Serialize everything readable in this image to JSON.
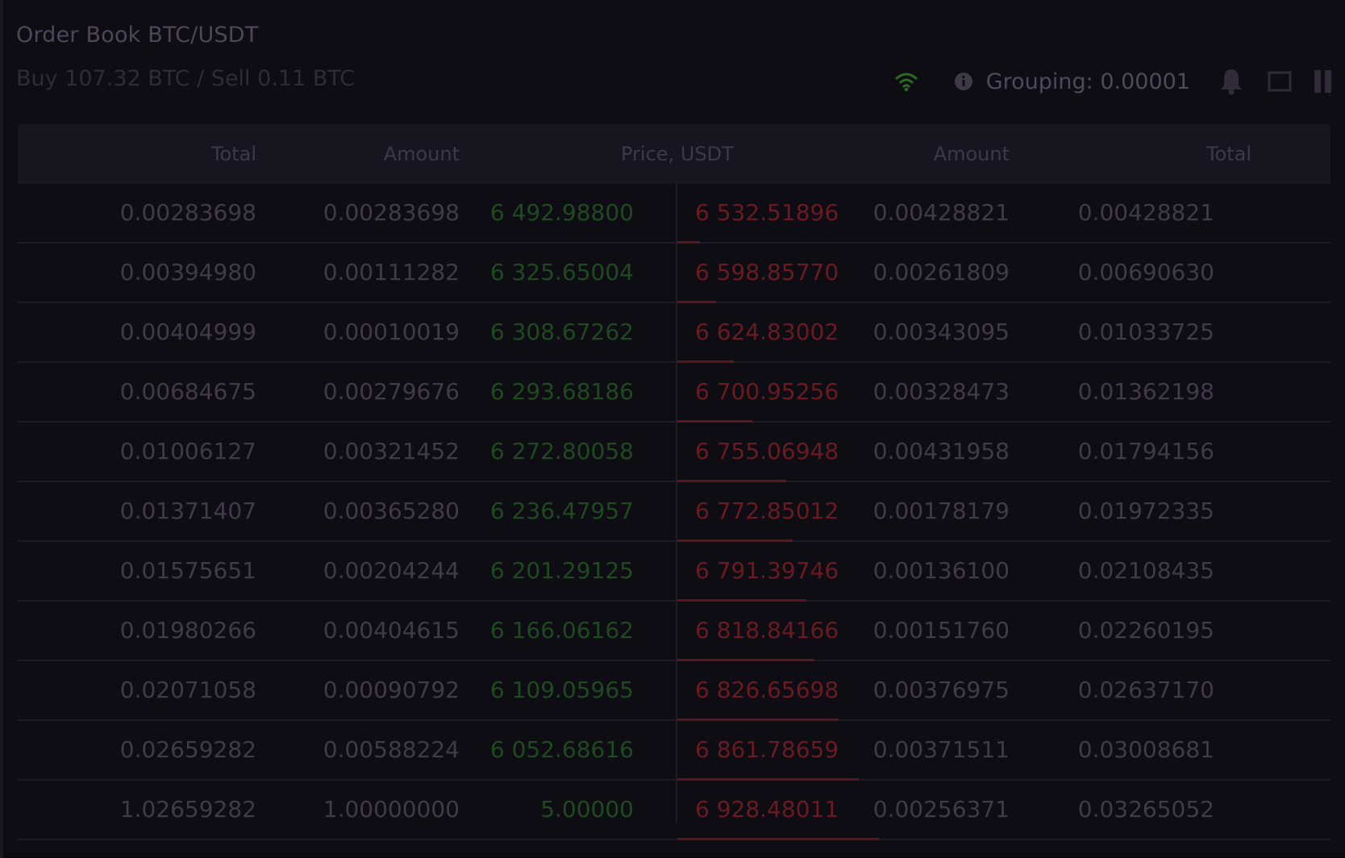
{
  "header": {
    "title": "Order Book BTC/USDT",
    "summary": "Buy 107.32 BTC / Sell 0.11 BTC",
    "grouping": "Grouping: 0.00001"
  },
  "toolbar": {
    "icons": [
      "wifi-icon",
      "info-icon",
      "bell-icon",
      "window-icon",
      "pause-icon"
    ]
  },
  "columns": {
    "bid_total": "Total",
    "bid_amount": "Amount",
    "price": "Price, USDT",
    "ask_amount": "Amount",
    "ask_total": "Total"
  },
  "colors": {
    "bid_price": "#1f4a20",
    "ask_price": "#6a1a20",
    "wifi": "#2b6a22",
    "depth_bar": "#5a171c"
  },
  "rows": [
    {
      "bid_total": "0.00283698",
      "bid_amount": "0.00283698",
      "bid_price": "6 492.98800",
      "ask_price": "6 532.51896",
      "ask_amount": "0.00428821",
      "ask_total": "0.00428821",
      "ask_depth": 0.11
    },
    {
      "bid_total": "0.00394980",
      "bid_amount": "0.00111282",
      "bid_price": "6 325.65004",
      "ask_price": "6 598.85770",
      "ask_amount": "0.00261809",
      "ask_total": "0.00690630",
      "ask_depth": 0.19
    },
    {
      "bid_total": "0.00404999",
      "bid_amount": "0.00010019",
      "bid_price": "6 308.67262",
      "ask_price": "6 624.83002",
      "ask_amount": "0.00343095",
      "ask_total": "0.01033725",
      "ask_depth": 0.28
    },
    {
      "bid_total": "0.00684675",
      "bid_amount": "0.00279676",
      "bid_price": "6 293.68186",
      "ask_price": "6 700.95256",
      "ask_amount": "0.00328473",
      "ask_total": "0.01362198",
      "ask_depth": 0.37
    },
    {
      "bid_total": "0.01006127",
      "bid_amount": "0.00321452",
      "bid_price": "6 272.80058",
      "ask_price": "6 755.06948",
      "ask_amount": "0.00431958",
      "ask_total": "0.01794156",
      "ask_depth": 0.54
    },
    {
      "bid_total": "0.01371407",
      "bid_amount": "0.00365280",
      "bid_price": "6 236.47957",
      "ask_price": "6 772.85012",
      "ask_amount": "0.00178179",
      "ask_total": "0.01972335",
      "ask_depth": 0.57
    },
    {
      "bid_total": "0.01575651",
      "bid_amount": "0.00204244",
      "bid_price": "6 201.29125",
      "ask_price": "6 791.39746",
      "ask_amount": "0.00136100",
      "ask_total": "0.02108435",
      "ask_depth": 0.64
    },
    {
      "bid_total": "0.01980266",
      "bid_amount": "0.00404615",
      "bid_price": "6 166.06162",
      "ask_price": "6 818.84166",
      "ask_amount": "0.00151760",
      "ask_total": "0.02260195",
      "ask_depth": 0.68
    },
    {
      "bid_total": "0.02071058",
      "bid_amount": "0.00090792",
      "bid_price": "6 109.05965",
      "ask_price": "6 826.65698",
      "ask_amount": "0.00376975",
      "ask_total": "0.02637170",
      "ask_depth": 0.8
    },
    {
      "bid_total": "0.02659282",
      "bid_amount": "0.00588224",
      "bid_price": "6 052.68616",
      "ask_price": "6 861.78659",
      "ask_amount": "0.00371511",
      "ask_total": "0.03008681",
      "ask_depth": 0.9
    },
    {
      "bid_total": "1.02659282",
      "bid_amount": "1.00000000",
      "bid_price": "5.00000",
      "ask_price": "6 928.48011",
      "ask_amount": "0.00256371",
      "ask_total": "0.03265052",
      "ask_depth": 1.0
    }
  ]
}
